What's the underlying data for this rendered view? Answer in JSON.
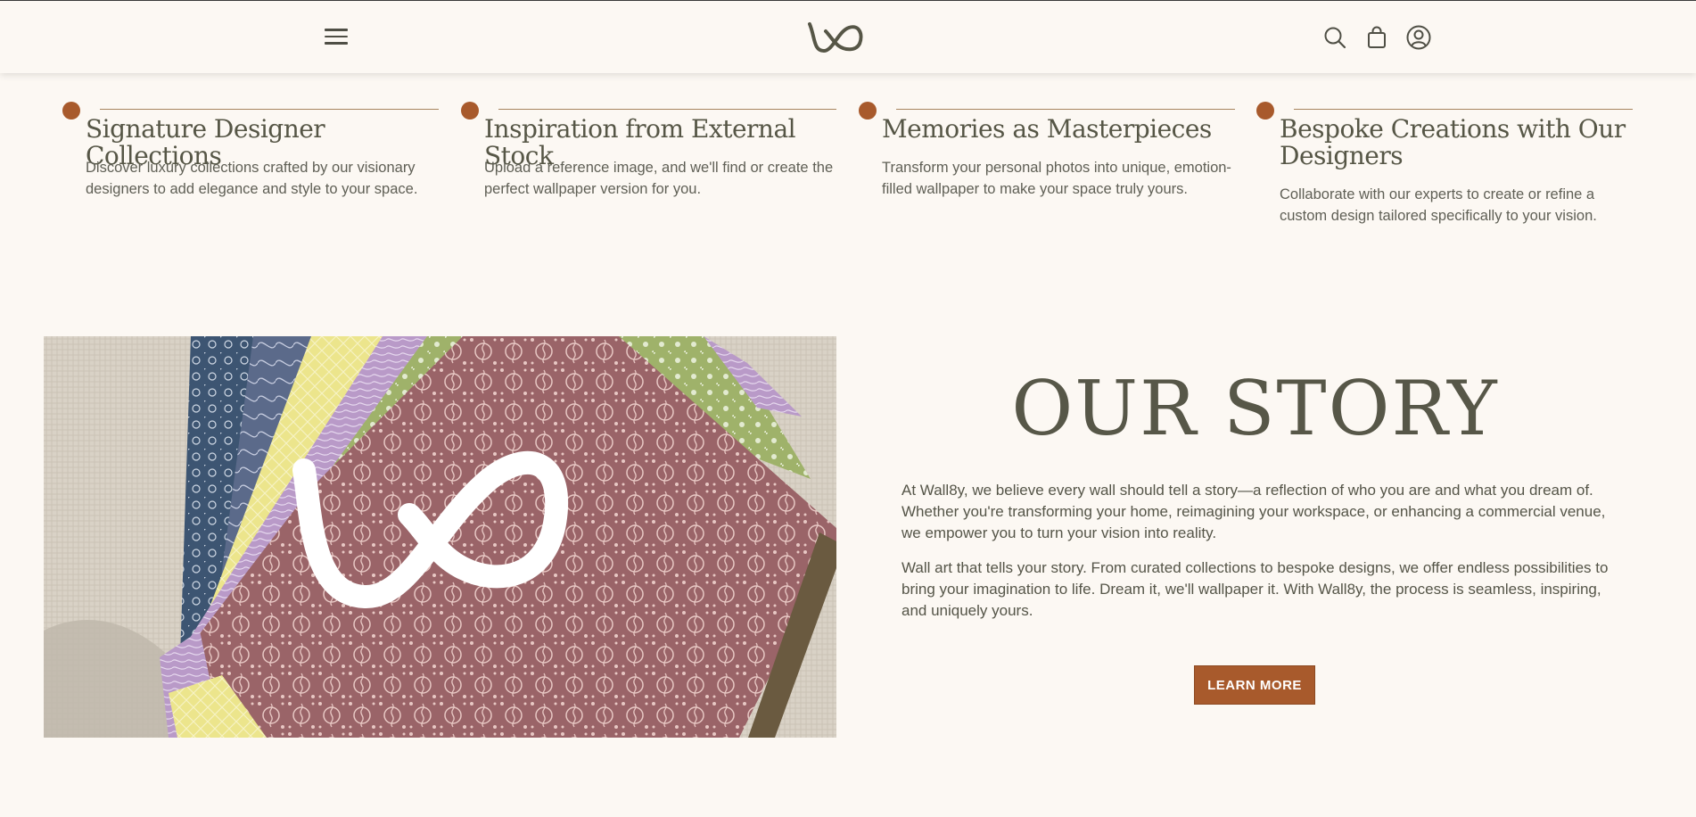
{
  "header": {
    "menu_icon": "hamburger-menu-icon",
    "logo_icon": "wall8y-infinity-logo",
    "search_icon": "search-icon",
    "cart_icon": "shopping-bag-icon",
    "account_icon": "user-account-icon"
  },
  "features": [
    {
      "title": "Signature Designer Collections",
      "description": "Discover luxury collections crafted by our visionary designers to add elegance and style to your space."
    },
    {
      "title": "Inspiration from External Stock",
      "description": "Upload a reference image, and we'll find or create the perfect wallpaper version for you."
    },
    {
      "title": "Memories as Masterpieces",
      "description": "Transform your personal photos into unique, emotion-filled wallpaper to make your space truly yours."
    },
    {
      "title": "Bespoke Creations with Our Designers",
      "description": "Collaborate with our experts to create or refine a custom design tailored specifically to your vision."
    }
  ],
  "story": {
    "title": "OUR STORY",
    "paragraph_1": "At Wall8y, we believe every wall should tell a story—a reflection of who you are and what you dream of. Whether you're transforming your home, reimagining your workspace, or enhancing a commercial venue, we empower you to turn your vision into reality.",
    "paragraph_2": "Wall art that tells your story. From curated collections to bespoke designs, we offer endless possibilities to bring your imagination to life. Dream it, we'll wallpaper it. With Wall8y, the process is seamless, inspiring, and uniquely yours.",
    "button_label": "LEARN MORE"
  },
  "colors": {
    "background": "#fcf8f3",
    "accent": "#a85a2c",
    "text": "#575748"
  }
}
